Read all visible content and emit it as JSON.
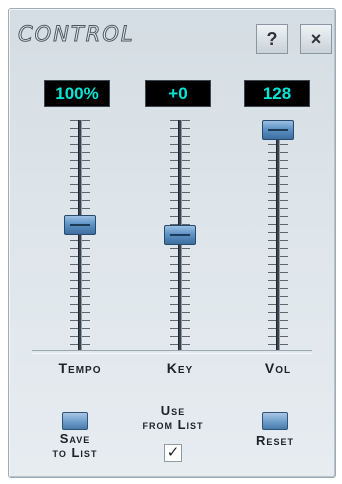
{
  "window": {
    "title": "CONTROL",
    "help_label": "?",
    "close_label": "×"
  },
  "sliders": [
    {
      "label": "Tempo",
      "display": "100%",
      "level": 0.55
    },
    {
      "label": "Key",
      "display": "+0",
      "level": 0.5
    },
    {
      "label": "Vol",
      "display": "128",
      "level": 1.0
    }
  ],
  "buttons": {
    "save_line1": "Save",
    "save_line2": "to List",
    "use_line1": "Use",
    "use_line2": "from List",
    "reset_label": "Reset"
  },
  "checkbox": {
    "checked": true,
    "glyph": "✓"
  },
  "colors": {
    "display_text": "#00e6d6",
    "thumb": "#5d93c6",
    "panel": "#dfe6eb"
  }
}
